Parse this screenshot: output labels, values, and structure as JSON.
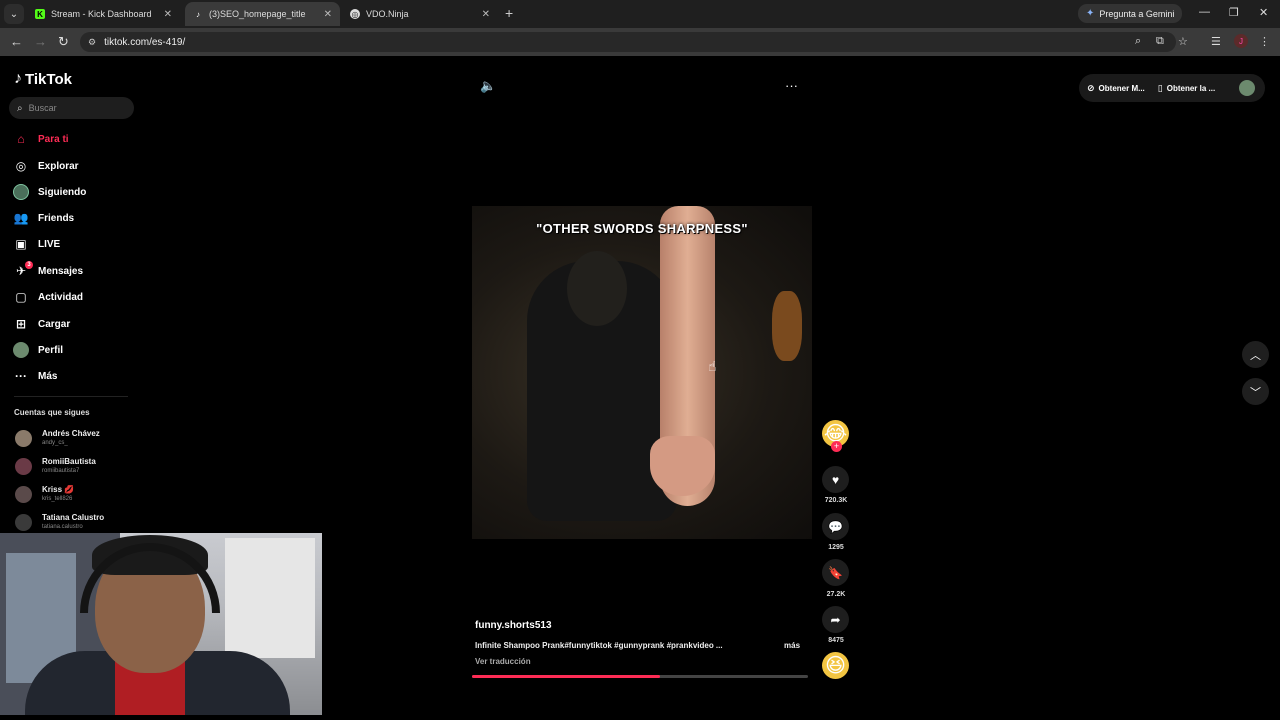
{
  "browser": {
    "tabs": [
      {
        "title": "Stream - Kick Dashboard",
        "icon": "kick-icon"
      },
      {
        "title": "(3)SEO_homepage_title",
        "icon": "tiktok-icon"
      },
      {
        "title": "VDO.Ninja",
        "icon": "vdo-ninja-icon"
      }
    ],
    "active_tab_index": 1,
    "gemini_label": "Pregunta a Gemini",
    "url": "tiktok.com/es-419/"
  },
  "tiktok": {
    "logo": "TikTok",
    "search_placeholder": "Buscar",
    "nav": [
      {
        "label": "Para ti",
        "icon": "home-icon",
        "active": true
      },
      {
        "label": "Explorar",
        "icon": "compass-icon"
      },
      {
        "label": "Siguiendo",
        "icon": "following-avatar-icon"
      },
      {
        "label": "Friends",
        "icon": "friends-icon"
      },
      {
        "label": "LIVE",
        "icon": "live-icon"
      },
      {
        "label": "Mensajes",
        "icon": "messages-icon",
        "badge": "3"
      },
      {
        "label": "Actividad",
        "icon": "activity-icon"
      },
      {
        "label": "Cargar",
        "icon": "upload-icon"
      },
      {
        "label": "Perfil",
        "icon": "profile-avatar-icon"
      },
      {
        "label": "Más",
        "icon": "more-dots-icon"
      }
    ],
    "following_header": "Cuentas que sigues",
    "following": [
      {
        "name": "Andrés Chávez",
        "username": "andy_cs_"
      },
      {
        "name": "RomiiBautista",
        "username": "romiibautista7"
      },
      {
        "name": "Kriss 💋",
        "username": "kris_tell826"
      },
      {
        "name": "Tatiana Calustro",
        "username": "tatiana.calustro"
      }
    ],
    "top_right": {
      "get_app_1": "Obtener M...",
      "get_app_2": "Obtener la ..."
    },
    "video": {
      "caption_overlay": "\"OTHER SWORDS SHARPNESS\"",
      "creator": "funny.shorts513",
      "description": "Infinite Shampoo Prank#funnytiktok #gunnyprank #prankvideo ...",
      "more_label": "más",
      "translate_label": "Ver traducción",
      "progress": 0.56,
      "likes": "720.3K",
      "comments": "1295",
      "saves": "27.2K",
      "shares": "8475"
    }
  },
  "colors": {
    "accent": "#fe2c55",
    "background": "#000000",
    "chrome_tabbar": "#1f1f1f",
    "chrome_toolbar": "#3a3a3a"
  }
}
